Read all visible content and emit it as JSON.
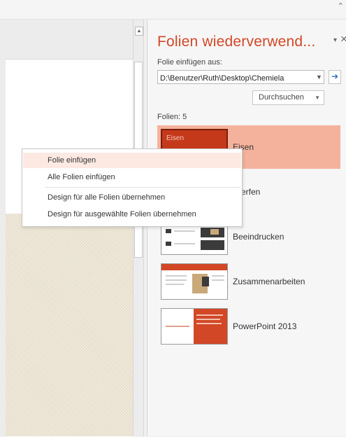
{
  "pane": {
    "title": "Folien wiederverwend...",
    "menu_icon": "▾",
    "close_icon": "×",
    "insert_from_label": "Folie einfügen aus:",
    "path_value": "D:\\Benutzer\\Ruth\\Desktop\\Chemiela",
    "browse_label": "Durchsuchen",
    "slides_count_label": "Folien: 5",
    "slides": [
      {
        "label": "Eisen",
        "thumb_text": "Eisen",
        "selected": true
      },
      {
        "label": "twerfen"
      },
      {
        "label": "Beeindrucken"
      },
      {
        "label": "Zusammenarbeiten"
      },
      {
        "label": "PowerPoint 2013"
      }
    ]
  },
  "context_menu": {
    "items": [
      {
        "label": "Folie einfügen",
        "highlighted": true
      },
      {
        "label": "Alle Folien einfügen"
      },
      {
        "label": "Design für alle Folien übernehmen"
      },
      {
        "label": "Design für ausgewählte Folien übernehmen"
      }
    ]
  },
  "colors": {
    "accent": "#d24726",
    "selection": "#f4b29c",
    "menu_highlight": "#fde9e2"
  }
}
